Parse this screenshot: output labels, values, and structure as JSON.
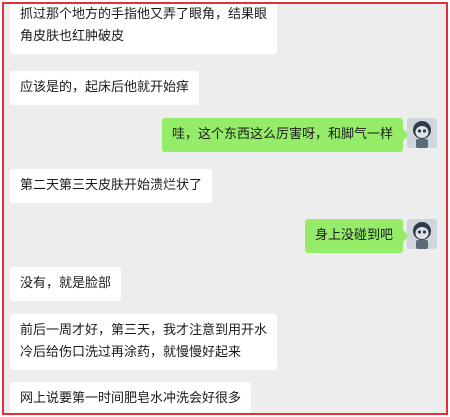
{
  "chat": {
    "messages": [
      {
        "side": "left",
        "lines": [
          "抓过那个地方的手指他又弄了眼角，结果眼",
          "角皮肤也红肿破皮"
        ]
      },
      {
        "side": "left",
        "lines": [
          "应该是的，起床后他就开始痒"
        ]
      },
      {
        "side": "right",
        "lines": [
          "哇，这个东西这么厉害呀，和脚气一样"
        ]
      },
      {
        "side": "left",
        "lines": [
          "第二天第三天皮肤开始溃烂状了"
        ]
      },
      {
        "side": "right",
        "lines": [
          "身上没碰到吧"
        ]
      },
      {
        "side": "left",
        "lines": [
          "没有，就是脸部"
        ]
      },
      {
        "side": "left",
        "lines": [
          "前后一周才好，第三天，我才注意到用开水",
          "冷后给伤口洗过再涂药，就慢慢好起来"
        ]
      },
      {
        "side": "left",
        "lines": [
          "网上说要第一时间肥皂水冲洗会好很多"
        ]
      }
    ],
    "avatar_icon": "cartoon-avatar-icon"
  },
  "colors": {
    "frame_border": "#e0303b",
    "chat_background": "#ededed",
    "incoming_bubble": "#ffffff",
    "outgoing_bubble": "#95ec69"
  }
}
